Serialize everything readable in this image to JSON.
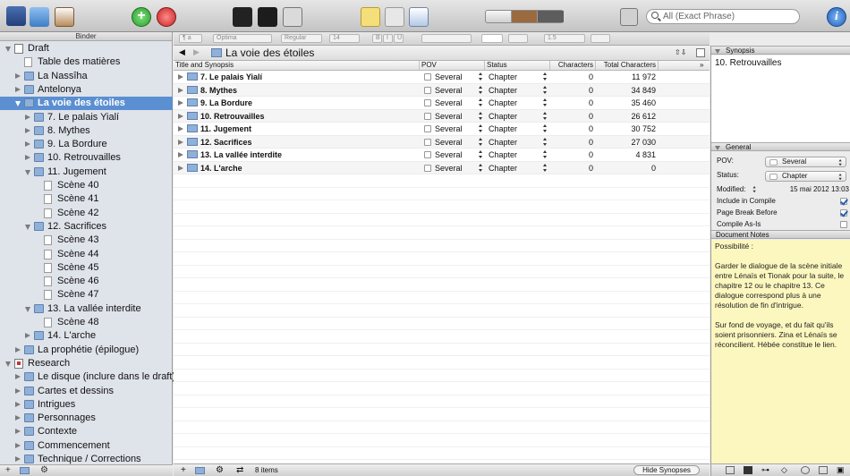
{
  "toolbar": {
    "search_placeholder": "All (Exact Phrase)"
  },
  "binder": {
    "header": "Binder",
    "items": [
      {
        "label": "Draft",
        "indent": 0,
        "icon": "draft-icon",
        "tri": "d"
      },
      {
        "label": "Table des matières",
        "indent": 1,
        "icon": "doc-icon",
        "tri": ""
      },
      {
        "label": "La Nassîha",
        "indent": 1,
        "icon": "folder-icon",
        "tri": "r"
      },
      {
        "label": "Antelonya",
        "indent": 1,
        "icon": "folder-icon",
        "tri": "r"
      },
      {
        "label": "La voie des étoiles",
        "indent": 1,
        "icon": "folder-icon",
        "tri": "d",
        "selected": true
      },
      {
        "label": "7. Le palais Yialí",
        "indent": 2,
        "icon": "folder-icon",
        "tri": "r"
      },
      {
        "label": "8. Mythes",
        "indent": 2,
        "icon": "folder-icon",
        "tri": "r"
      },
      {
        "label": "9. La Bordure",
        "indent": 2,
        "icon": "folder-icon",
        "tri": "r"
      },
      {
        "label": "10. Retrouvailles",
        "indent": 2,
        "icon": "folder-icon",
        "tri": "r"
      },
      {
        "label": "11. Jugement",
        "indent": 2,
        "icon": "folder-icon",
        "tri": "d"
      },
      {
        "label": "Scène 40",
        "indent": 3,
        "icon": "doc-icon",
        "tri": ""
      },
      {
        "label": "Scène 41",
        "indent": 3,
        "icon": "doc-icon",
        "tri": ""
      },
      {
        "label": "Scène 42",
        "indent": 3,
        "icon": "doc-icon",
        "tri": ""
      },
      {
        "label": "12. Sacrifices",
        "indent": 2,
        "icon": "folder-icon",
        "tri": "d"
      },
      {
        "label": "Scène 43",
        "indent": 3,
        "icon": "doc-icon",
        "tri": ""
      },
      {
        "label": "Scène 44",
        "indent": 3,
        "icon": "doc-icon",
        "tri": ""
      },
      {
        "label": "Scène 45",
        "indent": 3,
        "icon": "doc-icon",
        "tri": ""
      },
      {
        "label": "Scène 46",
        "indent": 3,
        "icon": "doc-icon",
        "tri": ""
      },
      {
        "label": "Scène 47",
        "indent": 3,
        "icon": "doc-icon",
        "tri": ""
      },
      {
        "label": "13. La vallée interdite",
        "indent": 2,
        "icon": "folder-icon",
        "tri": "d"
      },
      {
        "label": "Scène 48",
        "indent": 3,
        "icon": "doc-icon",
        "tri": ""
      },
      {
        "label": "14. L'arche",
        "indent": 2,
        "icon": "folder-icon",
        "tri": "r"
      },
      {
        "label": "La prophétie (épilogue)",
        "indent": 1,
        "icon": "folder-icon",
        "tri": "r"
      },
      {
        "label": "Research",
        "indent": 0,
        "icon": "research-icon",
        "tri": "d"
      },
      {
        "label": "Le disque (inclure dans le draft)",
        "indent": 1,
        "icon": "folder-icon",
        "tri": "r"
      },
      {
        "label": "Cartes et dessins",
        "indent": 1,
        "icon": "folder-icon",
        "tri": "r"
      },
      {
        "label": "Intrigues",
        "indent": 1,
        "icon": "folder-icon",
        "tri": "r"
      },
      {
        "label": "Personnages",
        "indent": 1,
        "icon": "folder-icon",
        "tri": "r"
      },
      {
        "label": "Contexte",
        "indent": 1,
        "icon": "folder-icon",
        "tri": "r"
      },
      {
        "label": "Commencement",
        "indent": 1,
        "icon": "folder-icon",
        "tri": "r"
      },
      {
        "label": "Technique / Corrections",
        "indent": 1,
        "icon": "folder-icon",
        "tri": "r"
      }
    ]
  },
  "formatbar": {
    "style": "¶ a",
    "font": "Optima",
    "weight": "Regular",
    "size": "14",
    "bold": "B",
    "italic": "I",
    "underline": "U",
    "line_spacing": "1.5"
  },
  "editor": {
    "title": "La voie des étoiles",
    "columns": {
      "title": "Title and Synopsis",
      "pov": "POV",
      "status": "Status",
      "characters": "Characters",
      "total": "Total Characters"
    },
    "rows": [
      {
        "title": "7. Le palais Yialí",
        "pov": "Several",
        "status": "Chapter",
        "chars": "0",
        "total": "11 972"
      },
      {
        "title": "8. Mythes",
        "pov": "Several",
        "status": "Chapter",
        "chars": "0",
        "total": "34 849"
      },
      {
        "title": "9. La Bordure",
        "pov": "Several",
        "status": "Chapter",
        "chars": "0",
        "total": "35 460"
      },
      {
        "title": "10. Retrouvailles",
        "pov": "Several",
        "status": "Chapter",
        "chars": "0",
        "total": "26 612"
      },
      {
        "title": "11. Jugement",
        "pov": "Several",
        "status": "Chapter",
        "chars": "0",
        "total": "30 752"
      },
      {
        "title": "12. Sacrifices",
        "pov": "Several",
        "status": "Chapter",
        "chars": "0",
        "total": "27 030"
      },
      {
        "title": "13. La vallée interdite",
        "pov": "Several",
        "status": "Chapter",
        "chars": "0",
        "total": "4 831"
      },
      {
        "title": "14. L'arche",
        "pov": "Several",
        "status": "Chapter",
        "chars": "0",
        "total": "0"
      }
    ],
    "item_count": "8 items",
    "hide_synopses": "Hide Synopses"
  },
  "inspector": {
    "synopsis_header": "Synopsis",
    "synopsis_text": "10. Retrouvailles",
    "general_header": "General",
    "pov_label": "POV:",
    "pov_value": "Several",
    "status_label": "Status:",
    "status_value": "Chapter",
    "modified_label": "Modified:",
    "modified_value": "15 mai 2012 13:03",
    "include_compile": "Include in Compile",
    "page_break": "Page Break Before",
    "compile_as_is": "Compile As-Is",
    "notes_header": "Document Notes",
    "notes": [
      "Possibilité :",
      "Garder le dialogue de la scène initiale entre Lénaïs et Tionak pour la suite, le chapitre 12 ou le chapitre 13. Ce dialogue correspond plus à une résolution de fin d'intrigue.",
      "Sur fond de voyage, et du fait qu'ils soient prisonniers. Zina et Lénaïs se réconcilient. Hébée constitue le lien."
    ]
  },
  "colors": {
    "selection": "#5b8fd1",
    "notes_bg": "#fcf7be",
    "binder_bg": "#dfe3ea"
  }
}
